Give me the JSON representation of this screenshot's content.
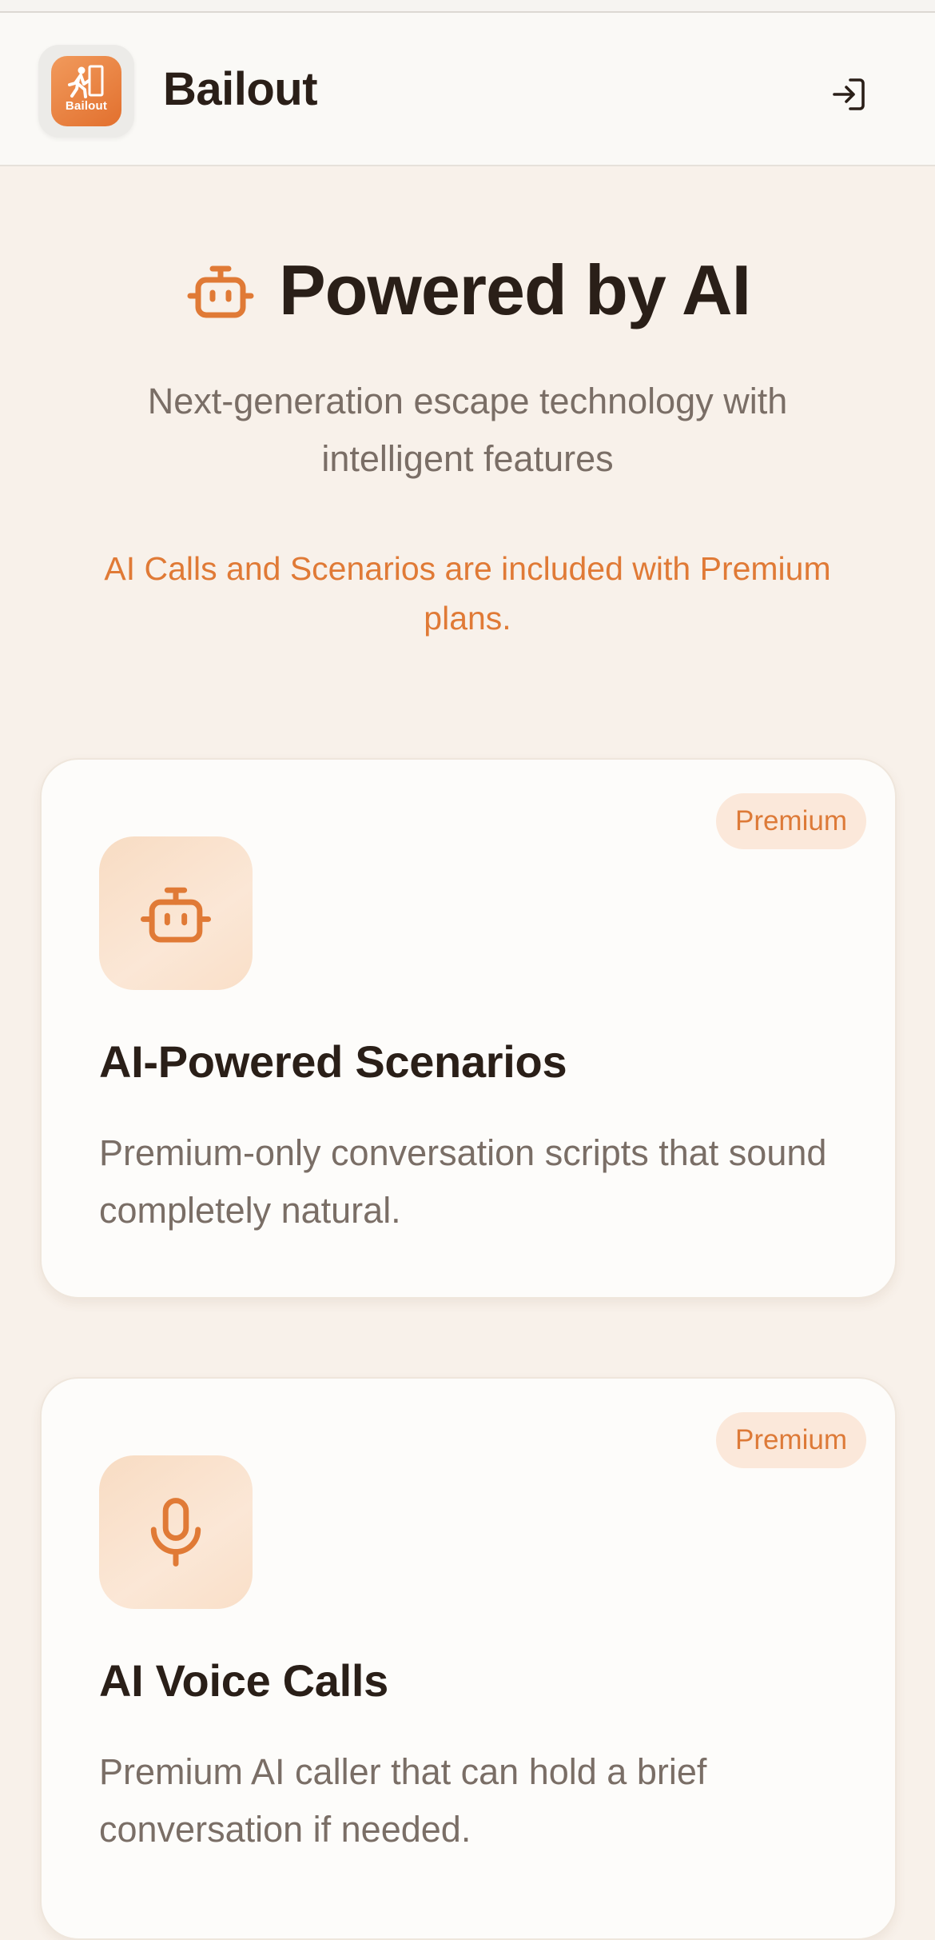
{
  "header": {
    "app_name": "Bailout",
    "logo_text": "Bailout",
    "signin_icon": "sign-in-icon"
  },
  "hero": {
    "icon": "robot-icon",
    "title": "Powered by AI",
    "subtitle": "Next-generation escape technology with intelligent features",
    "note": "AI Calls and Scenarios are included with Premium plans."
  },
  "features": [
    {
      "badge": "Premium",
      "icon": "robot-icon",
      "title": "AI-Powered Scenarios",
      "description": "Premium-only conversation scripts that sound completely natural."
    },
    {
      "badge": "Premium",
      "icon": "microphone-icon",
      "title": "AI Voice Calls",
      "description": "Premium AI caller that can hold a brief conversation if needed."
    }
  ],
  "colors": {
    "accent": "#e07a36",
    "background": "#f8f1ea",
    "card": "#fdfcfa",
    "badge_bg": "#fbe8da",
    "text_dark": "#2a1f18",
    "text_muted": "#7a6e66"
  }
}
